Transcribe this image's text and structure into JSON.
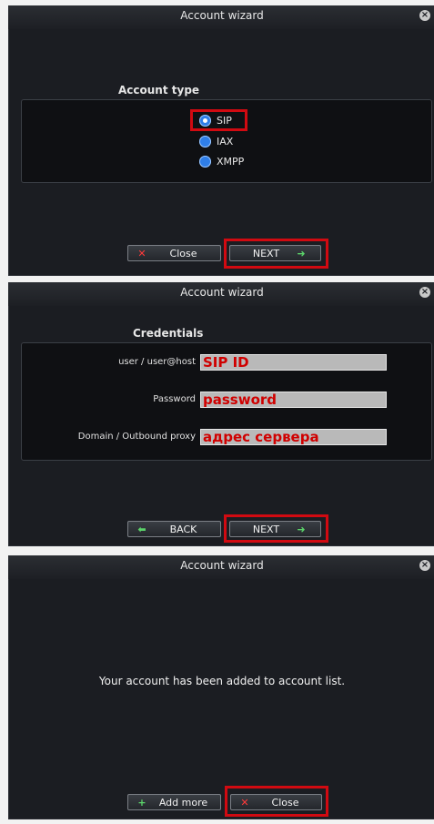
{
  "colors": {
    "background": "#1b1d22",
    "box": "#0f1013",
    "highlight": "#d10a11",
    "radio": "#2f7ee8",
    "button_border": "#7b7f86",
    "input_bg": "#b9b9b9",
    "input_text": "#d00000"
  },
  "screen1": {
    "title": "Account wizard",
    "section_title": "Account type",
    "options": [
      {
        "label": "SIP",
        "selected": true
      },
      {
        "label": "IAX",
        "selected": false
      },
      {
        "label": "XMPP",
        "selected": false
      }
    ],
    "close_label": "Close",
    "next_label": "NEXT",
    "icons": {
      "close": "close-x-icon",
      "next": "arrow-right-icon",
      "window_close": "window-close-icon"
    }
  },
  "screen2": {
    "title": "Account wizard",
    "section_title": "Credentials",
    "fields": [
      {
        "label": "user / user@host",
        "value": "SIP ID"
      },
      {
        "label": "Password",
        "value": "password"
      },
      {
        "label": "Domain / Outbound proxy",
        "value": "адрес сервера"
      }
    ],
    "back_label": "BACK",
    "next_label": "NEXT",
    "icons": {
      "back": "arrow-left-icon",
      "next": "arrow-right-icon",
      "window_close": "window-close-icon"
    }
  },
  "screen3": {
    "title": "Account wizard",
    "message": "Your account has been added to account list.",
    "add_more_label": "Add more",
    "close_label": "Close",
    "icons": {
      "add_more": "plus-icon",
      "close": "close-x-icon",
      "window_close": "window-close-icon"
    }
  }
}
